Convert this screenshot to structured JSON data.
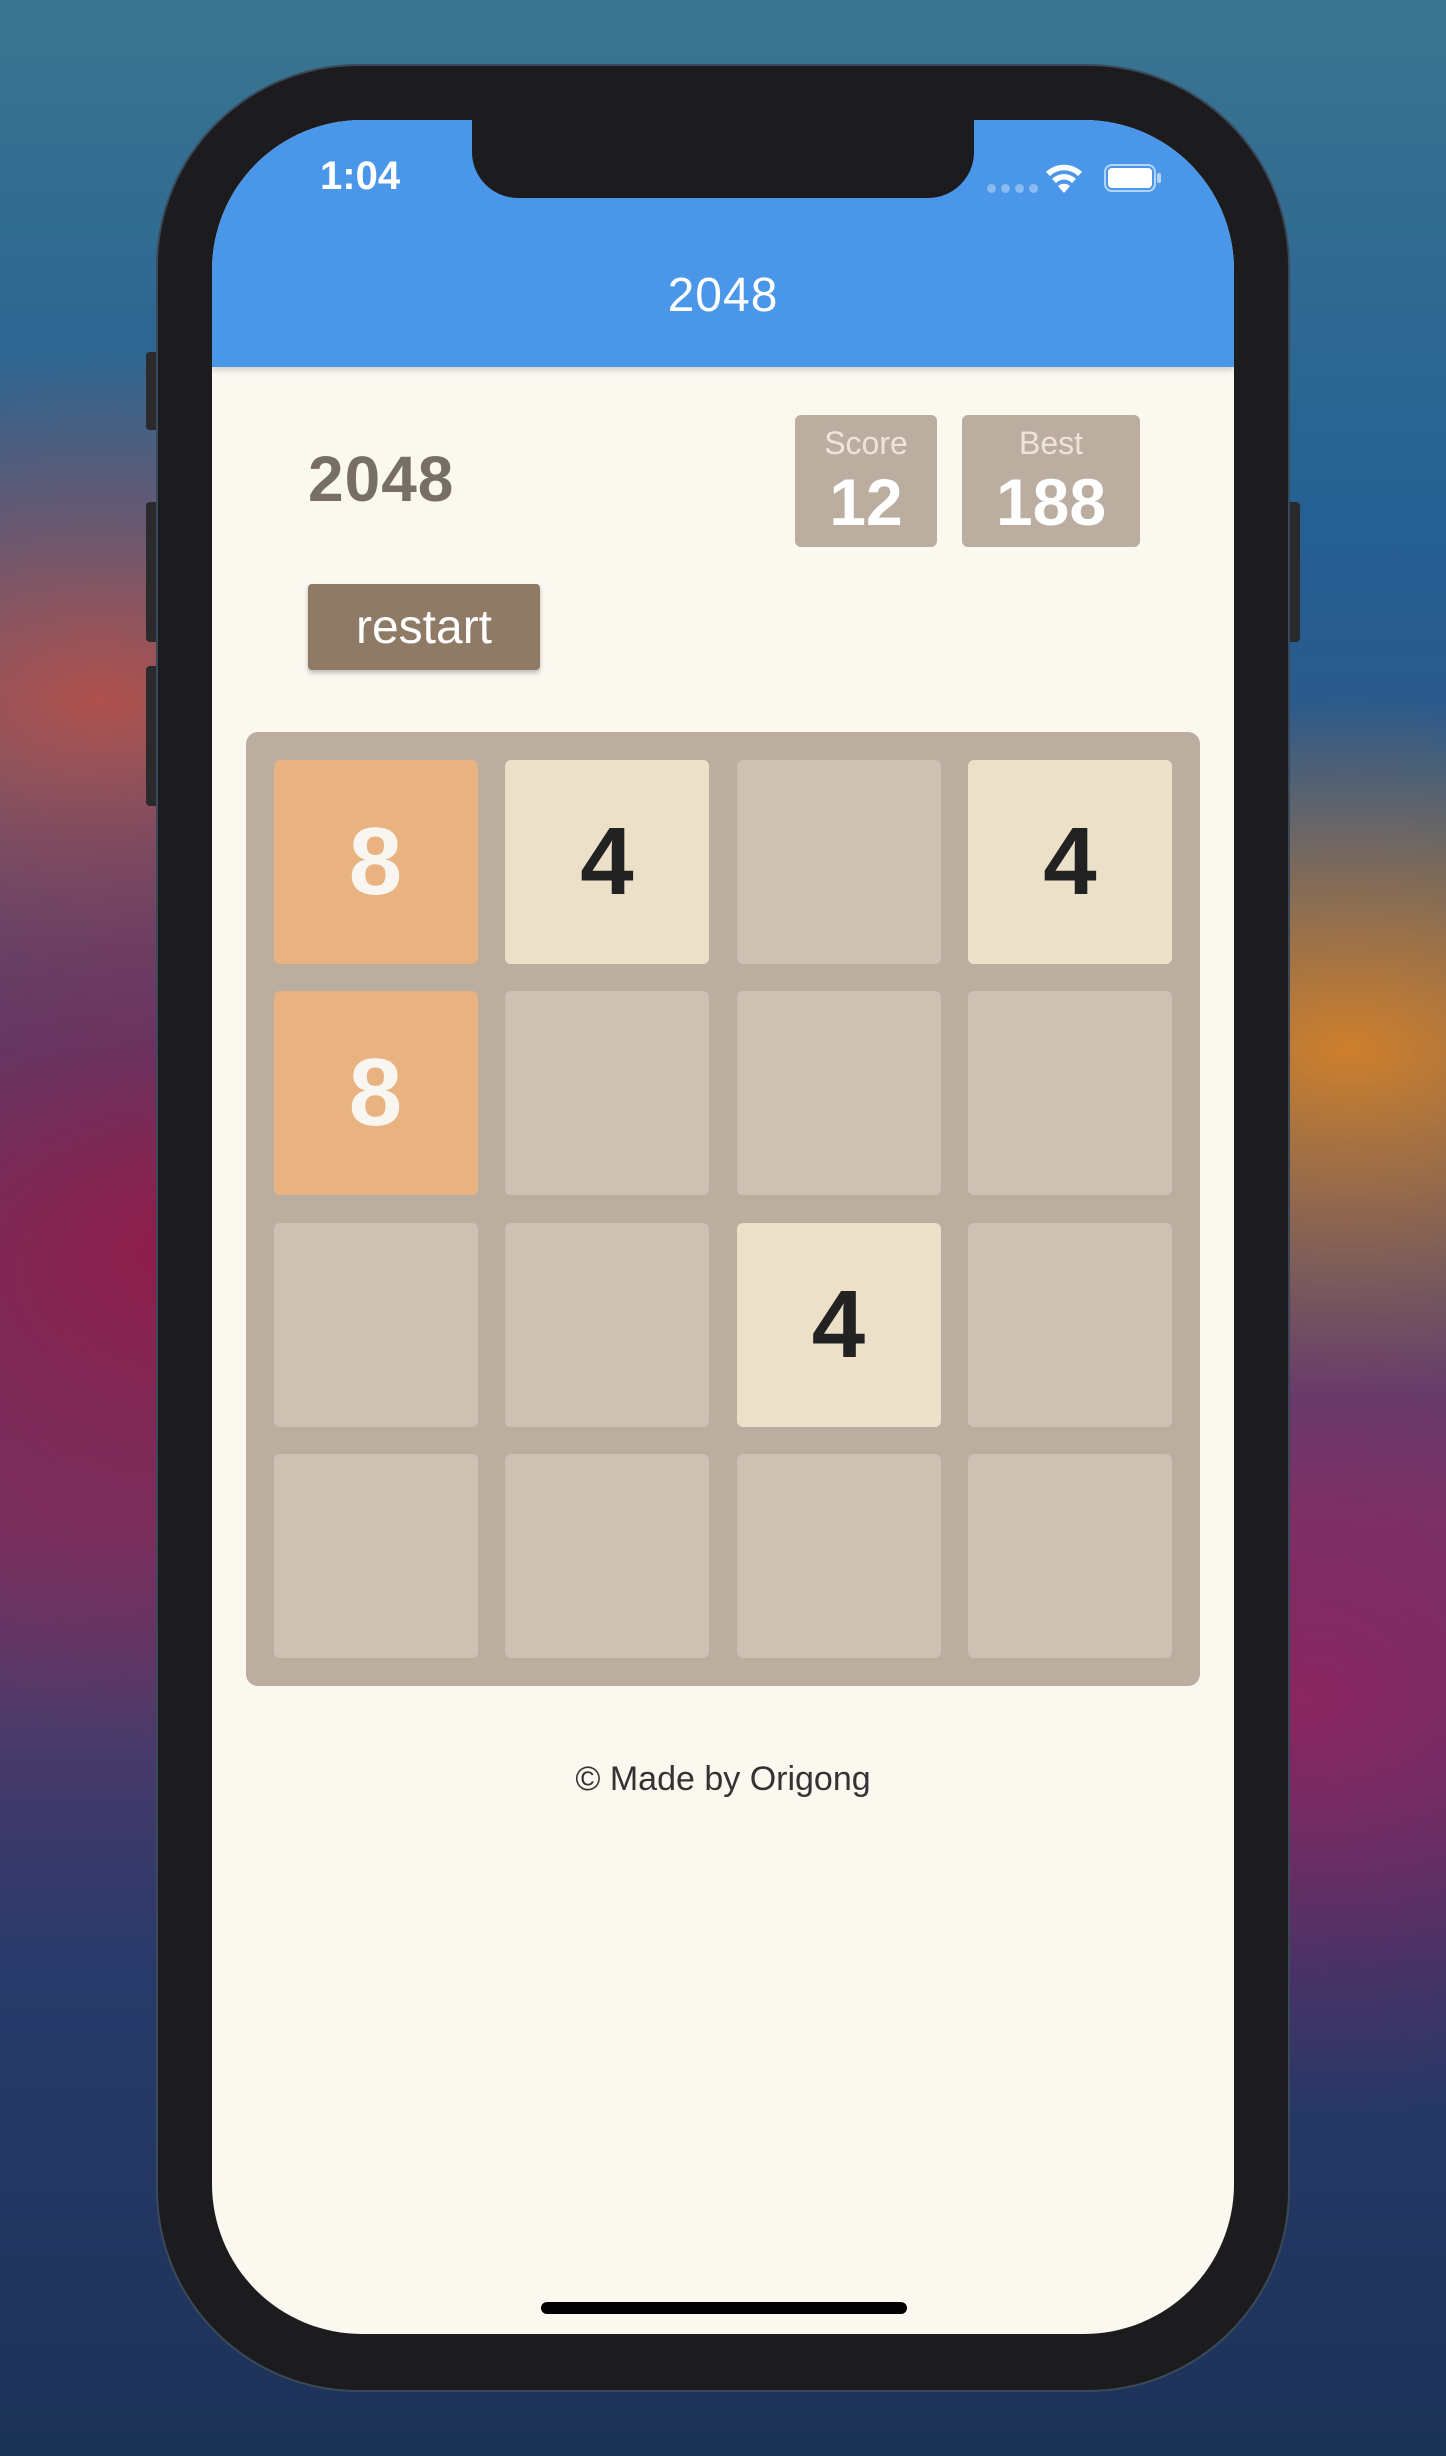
{
  "status_bar": {
    "time": "1:04",
    "icons": [
      "cellular-signal-icon",
      "wifi-icon",
      "battery-icon"
    ]
  },
  "app_bar": {
    "title": "2048",
    "color": "#4a97e9"
  },
  "game": {
    "title": "2048",
    "score_label": "Score",
    "score_value": "12",
    "best_label": "Best",
    "best_value": "188",
    "restart_label": "restart"
  },
  "board": {
    "rows": [
      [
        "8",
        "4",
        "",
        "4"
      ],
      [
        "8",
        "",
        "",
        ""
      ],
      [
        "",
        "",
        "4",
        ""
      ],
      [
        "",
        "",
        "",
        ""
      ]
    ]
  },
  "colors": {
    "tile_empty": "#cdc1b4",
    "tile_4": "#ede0c8",
    "tile_8": "#f2b179",
    "board": "#bbada0",
    "background": "#fbf8f0"
  },
  "footer": {
    "text": "© Made by Origong"
  }
}
